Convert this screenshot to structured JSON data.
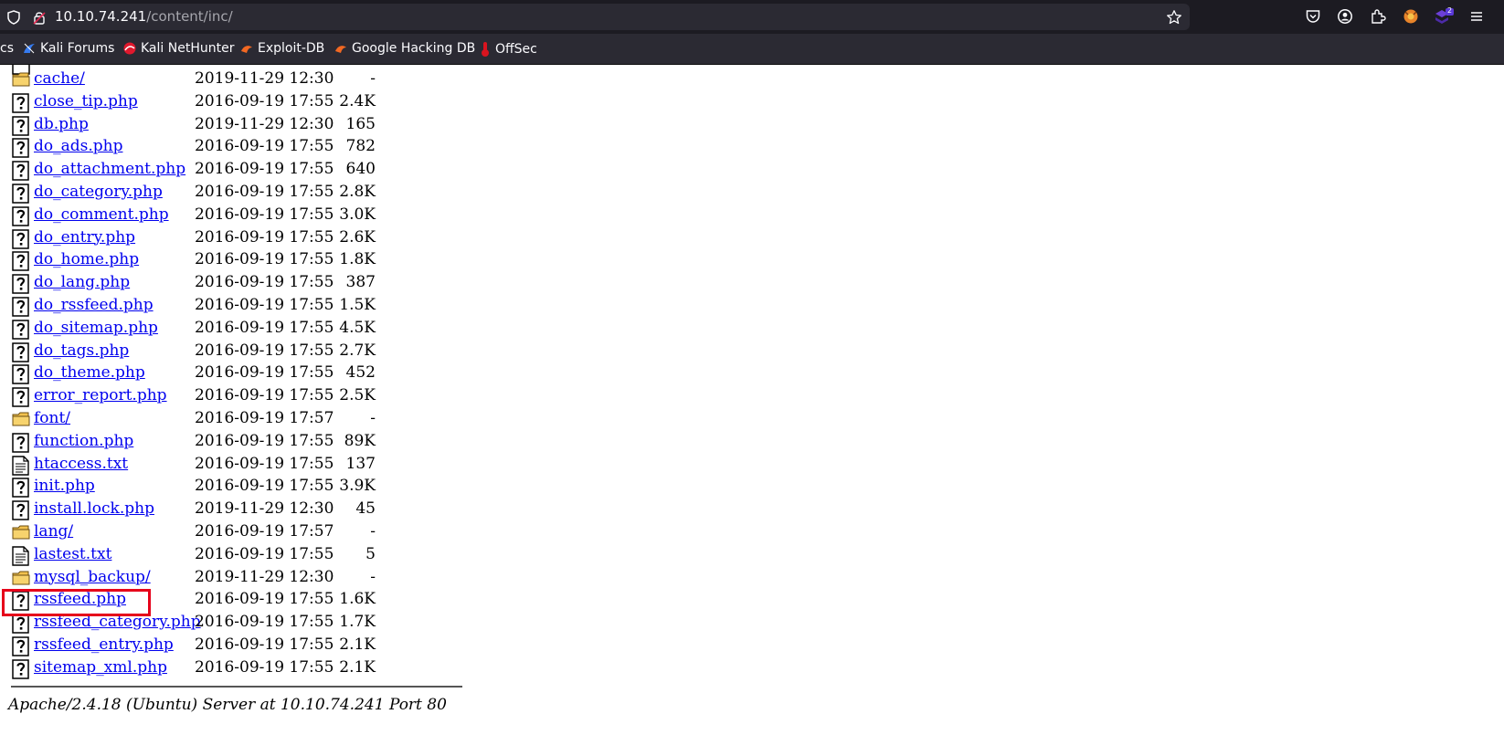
{
  "browser": {
    "url_host": "10.10.74.241",
    "url_path": "/content/inc/",
    "extension_badge": "2",
    "bookmarks": [
      {
        "label": "cs"
      },
      {
        "label": "Kali Forums"
      },
      {
        "label": "Kali NetHunter"
      },
      {
        "label": "Exploit-DB"
      },
      {
        "label": "Google Hacking DB"
      },
      {
        "label": "OffSec"
      }
    ]
  },
  "listing": {
    "rows": [
      {
        "name": "cache/",
        "date": "2019-11-29 12:30",
        "size": "-",
        "type": "folder"
      },
      {
        "name": "close_tip.php",
        "date": "2016-09-19 17:55",
        "size": "2.4K",
        "type": "unknown"
      },
      {
        "name": "db.php",
        "date": "2019-11-29 12:30",
        "size": "165",
        "type": "unknown"
      },
      {
        "name": "do_ads.php",
        "date": "2016-09-19 17:55",
        "size": "782",
        "type": "unknown"
      },
      {
        "name": "do_attachment.php",
        "date": "2016-09-19 17:55",
        "size": "640",
        "type": "unknown"
      },
      {
        "name": "do_category.php",
        "date": "2016-09-19 17:55",
        "size": "2.8K",
        "type": "unknown"
      },
      {
        "name": "do_comment.php",
        "date": "2016-09-19 17:55",
        "size": "3.0K",
        "type": "unknown"
      },
      {
        "name": "do_entry.php",
        "date": "2016-09-19 17:55",
        "size": "2.6K",
        "type": "unknown"
      },
      {
        "name": "do_home.php",
        "date": "2016-09-19 17:55",
        "size": "1.8K",
        "type": "unknown"
      },
      {
        "name": "do_lang.php",
        "date": "2016-09-19 17:55",
        "size": "387",
        "type": "unknown"
      },
      {
        "name": "do_rssfeed.php",
        "date": "2016-09-19 17:55",
        "size": "1.5K",
        "type": "unknown"
      },
      {
        "name": "do_sitemap.php",
        "date": "2016-09-19 17:55",
        "size": "4.5K",
        "type": "unknown"
      },
      {
        "name": "do_tags.php",
        "date": "2016-09-19 17:55",
        "size": "2.7K",
        "type": "unknown"
      },
      {
        "name": "do_theme.php",
        "date": "2016-09-19 17:55",
        "size": "452",
        "type": "unknown"
      },
      {
        "name": "error_report.php",
        "date": "2016-09-19 17:55",
        "size": "2.5K",
        "type": "unknown"
      },
      {
        "name": "font/",
        "date": "2016-09-19 17:57",
        "size": "-",
        "type": "folder"
      },
      {
        "name": "function.php",
        "date": "2016-09-19 17:55",
        "size": "89K",
        "type": "unknown"
      },
      {
        "name": "htaccess.txt",
        "date": "2016-09-19 17:55",
        "size": "137",
        "type": "text"
      },
      {
        "name": "init.php",
        "date": "2016-09-19 17:55",
        "size": "3.9K",
        "type": "unknown"
      },
      {
        "name": "install.lock.php",
        "date": "2019-11-29 12:30",
        "size": "45",
        "type": "unknown"
      },
      {
        "name": "lang/",
        "date": "2016-09-19 17:57",
        "size": "-",
        "type": "folder"
      },
      {
        "name": "lastest.txt",
        "date": "2016-09-19 17:55",
        "size": "5",
        "type": "text"
      },
      {
        "name": "mysql_backup/",
        "date": "2019-11-29 12:30",
        "size": "-",
        "type": "folder",
        "highlighted": true
      },
      {
        "name": "rssfeed.php",
        "date": "2016-09-19 17:55",
        "size": "1.6K",
        "type": "unknown"
      },
      {
        "name": "rssfeed_category.php",
        "date": "2016-09-19 17:55",
        "size": "1.7K",
        "type": "unknown"
      },
      {
        "name": "rssfeed_entry.php",
        "date": "2016-09-19 17:55",
        "size": "2.1K",
        "type": "unknown"
      },
      {
        "name": "sitemap_xml.php",
        "date": "2016-09-19 17:55",
        "size": "2.1K",
        "type": "unknown"
      }
    ]
  },
  "footer": {
    "signature": "Apache/2.4.18 (Ubuntu) Server at 10.10.74.241 Port 80"
  },
  "colors": {
    "link": "#0000ee",
    "highlight": "#e6001a",
    "chrome_bg": "#1c1b22",
    "urlbar_bg": "#2b2a33"
  }
}
